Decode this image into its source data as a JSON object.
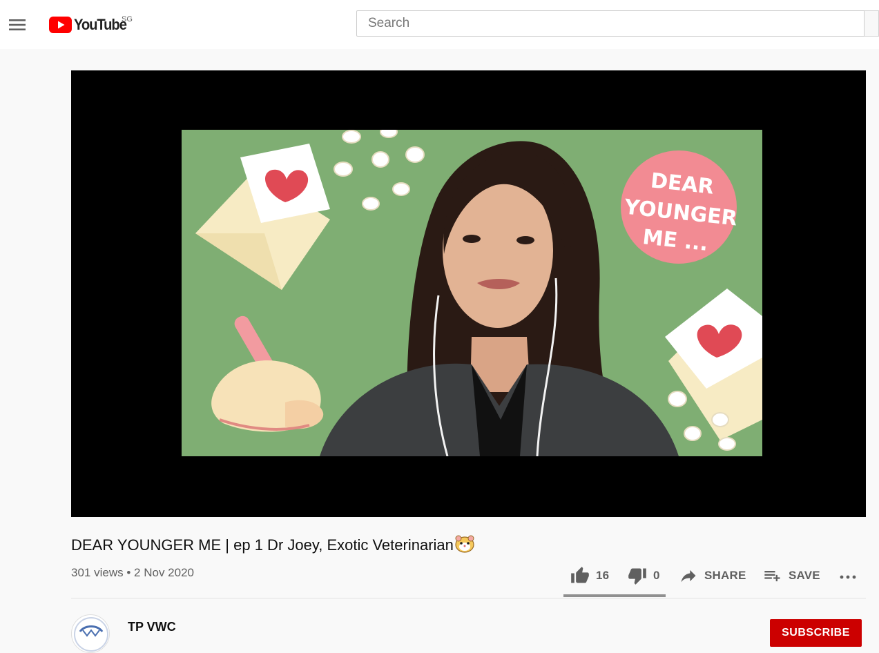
{
  "masthead": {
    "logo_text": "YouTube",
    "region": "SG",
    "search_placeholder": "Search"
  },
  "video": {
    "overlay_text": [
      "DEAR",
      "YOUNGER",
      "ME ..."
    ],
    "title": "DEAR YOUNGER ME | ep 1 Dr Joey, Exotic Veterinarian",
    "title_emoji": "hamster-face-icon",
    "views": "301 views",
    "separator": "•",
    "date": "2 Nov 2020"
  },
  "actions": {
    "like_count": "16",
    "dislike_count": "0",
    "share_label": "SHARE",
    "save_label": "SAVE",
    "like_ratio": 1.0
  },
  "channel": {
    "name": "TP VWC",
    "subscribe_label": "SUBSCRIBE"
  },
  "colors": {
    "brand_red": "#ff0000",
    "subscribe_red": "#cc0000",
    "video_background_green": "#7fae73",
    "bubble_pink": "#f28b93"
  }
}
